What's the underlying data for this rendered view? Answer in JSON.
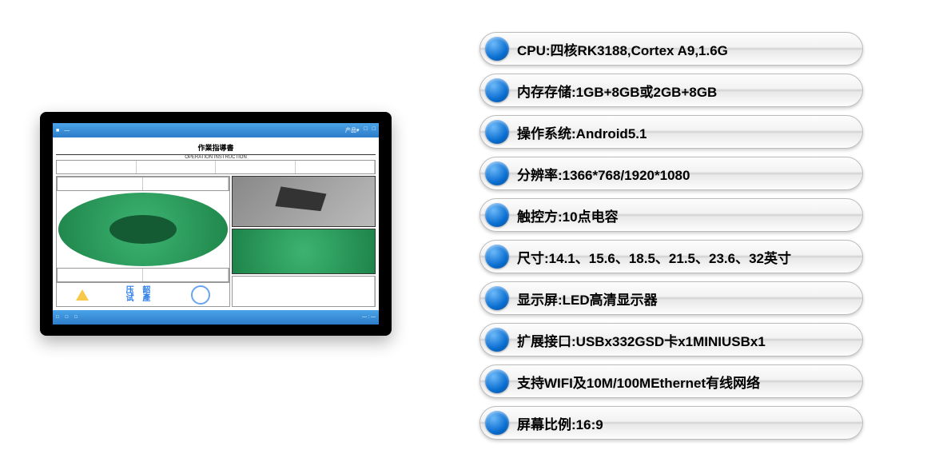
{
  "specs": [
    "CPU:四核RK3188,Cortex A9,1.6G",
    "内存存储:1GB+8GB或2GB+8GB",
    "操作系统:Android5.1",
    "分辨率:1366*768/1920*1080",
    "触控方:10点电容",
    "尺寸:14.1、15.6、18.5、21.5、23.6、32英寸",
    "显示屏:LED高清显示器",
    "扩展接口:USBx332GSD卡x1MINIUSBx1",
    "支持WIFI及10M/100MEthernet有线网络",
    "屏幕比例:16:9"
  ],
  "doc": {
    "title": "作業指導書",
    "subtitle": "OPERATION   INSTRUCTION",
    "stamp_text": "压 韶\n试 產"
  }
}
